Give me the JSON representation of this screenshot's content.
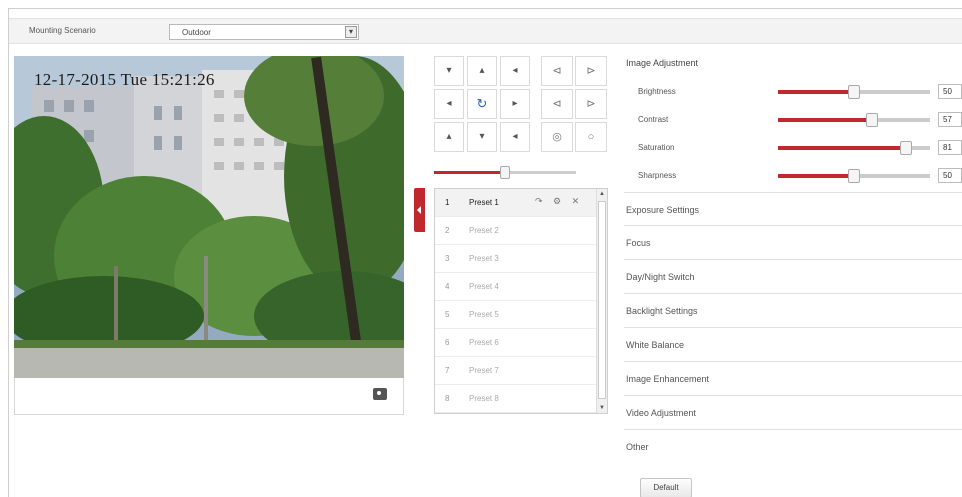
{
  "toolbar": {
    "mounting_label": "Mounting Scenario",
    "mounting_value": "Outdoor"
  },
  "video": {
    "osd_text": "12-17-2015  Tue 15:21:26"
  },
  "ptz": {
    "pan_buttons": [
      "▾",
      "▴",
      "◂",
      "◂",
      "↻",
      "▸",
      "▴",
      "▾",
      "◂"
    ],
    "lens_buttons": [
      "⊲",
      "⊳",
      "⊲",
      "⊳",
      "◎",
      "○"
    ],
    "speed_fraction": 0.5
  },
  "presets": {
    "rows": [
      {
        "num": "1",
        "name": "Preset 1"
      },
      {
        "num": "2",
        "name": "Preset 2"
      },
      {
        "num": "3",
        "name": "Preset 3"
      },
      {
        "num": "4",
        "name": "Preset 4"
      },
      {
        "num": "5",
        "name": "Preset 5"
      },
      {
        "num": "6",
        "name": "Preset 6"
      },
      {
        "num": "7",
        "name": "Preset 7"
      },
      {
        "num": "8",
        "name": "Preset 8"
      }
    ],
    "row_icons": "↷ ⚙ ✕"
  },
  "settings": {
    "image_adjustment_title": "Image Adjustment",
    "sliders": [
      {
        "label": "Brightness",
        "value": "50",
        "fraction": 0.5
      },
      {
        "label": "Contrast",
        "value": "57",
        "fraction": 0.62
      },
      {
        "label": "Saturation",
        "value": "81",
        "fraction": 0.84
      },
      {
        "label": "Sharpness",
        "value": "50",
        "fraction": 0.5
      }
    ],
    "sections": [
      "Exposure Settings",
      "Focus",
      "Day/Night Switch",
      "Backlight Settings",
      "White Balance",
      "Image Enhancement",
      "Video Adjustment",
      "Other"
    ],
    "default_button": "Default"
  },
  "colors": {
    "accent": "#c0282d"
  }
}
